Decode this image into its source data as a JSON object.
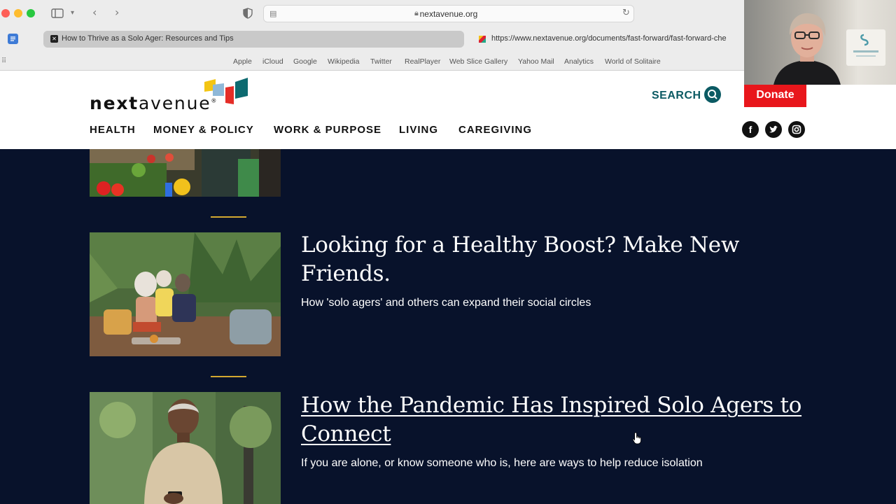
{
  "browser": {
    "address": "nextavenue.org",
    "tabs": [
      {
        "title": "How to Thrive as a Solo Ager: Resources and Tips"
      },
      {
        "title": "https://www.nextavenue.org/documents/fast-forward/fast-forward-che"
      }
    ],
    "bookmarks": [
      "Apple",
      "iCloud",
      "Google",
      "Wikipedia",
      "Twitter",
      "RealPlayer",
      "Web Slice Gallery",
      "Yahoo Mail",
      "Analytics",
      "World of Solitaire"
    ]
  },
  "site": {
    "logo_light": "next",
    "logo_rest": "avenue",
    "logo_reg": "®",
    "search_label": "SEARCH",
    "donate_label": "Donate",
    "nav": [
      "HEALTH",
      "MONEY & POLICY",
      "WORK & PURPOSE",
      "LIVING",
      "CAREGIVING"
    ],
    "social_icons": [
      "facebook-icon",
      "twitter-icon",
      "instagram-icon"
    ]
  },
  "articles": [
    {
      "headline": "Looking for a Healthy Boost? Make New Friends.",
      "dek": "How 'solo agers' and others can expand their social circles"
    },
    {
      "headline": "How the Pandemic Has Inspired Solo Agers to Connect",
      "dek": "If you are alone, or know someone who is, here are ways to help reduce isolation"
    }
  ],
  "colors": {
    "content_bg": "#08122b",
    "accent_teal": "#0b5a63",
    "donate_red": "#e8161b",
    "divider_gold": "#d3a830"
  }
}
